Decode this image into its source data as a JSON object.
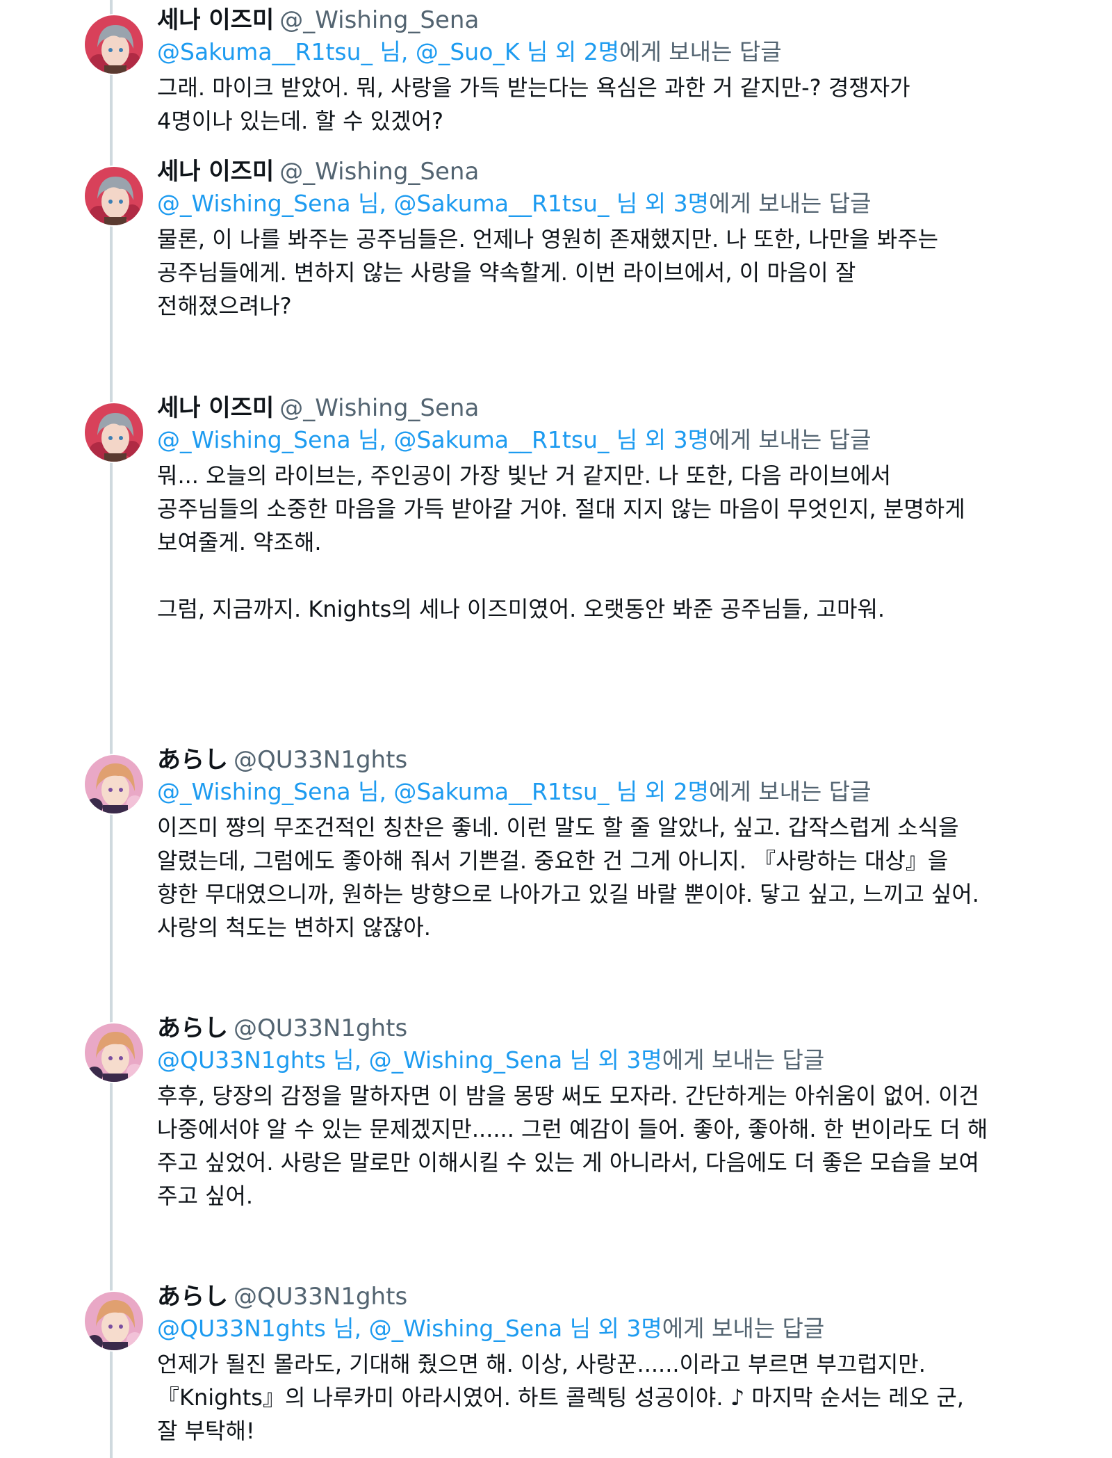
{
  "tweets": [
    {
      "display_name": "세나 이즈미",
      "handle": "@_Wishing_Sena",
      "reply_mentions": "@Sakuma__R1tsu_ 님, @_Suo_K 님 외 2명",
      "reply_suffix": "에게 보내는 답글",
      "text": "그래. 마이크 받았어. 뭐, 사랑을 가득 받는다는 욕심은 과한 거 같지만-? 경쟁자가\n4명이나 있는데. 할 수 있겠어?",
      "avatar_colors": {
        "bg": "#d8415a",
        "hair": "#9aa3ad",
        "skin": "#f3d6c8"
      }
    },
    {
      "display_name": "세나 이즈미",
      "handle": "@_Wishing_Sena",
      "reply_mentions": "@_Wishing_Sena 님, @Sakuma__R1tsu_ 님 외 3명",
      "reply_suffix": "에게 보내는 답글",
      "text": "물론, 이 나를 봐주는 공주님들은. 언제나 영원히 존재했지만. 나 또한, 나만을 봐주는\n공주님들에게. 변하지 않는 사랑을 약속할게. 이번 라이브에서, 이 마음이 잘\n전해졌으려나?",
      "avatar_colors": {
        "bg": "#d8415a",
        "hair": "#9aa3ad",
        "skin": "#f3d6c8"
      }
    },
    {
      "display_name": "세나 이즈미",
      "handle": "@_Wishing_Sena",
      "reply_mentions": "@_Wishing_Sena 님, @Sakuma__R1tsu_ 님 외 3명",
      "reply_suffix": "에게 보내는 답글",
      "text": "뭐... 오늘의 라이브는, 주인공이 가장 빛난 거 같지만. 나 또한, 다음 라이브에서\n공주님들의 소중한 마음을 가득 받아갈 거야. 절대 지지 않는 마음이 무엇인지, 분명하게\n보여줄게. 약조해.\n\n그럼, 지금까지. Knights의 세나 이즈미였어. 오랫동안 봐준 공주님들, 고마워.",
      "avatar_colors": {
        "bg": "#d8415a",
        "hair": "#9aa3ad",
        "skin": "#f3d6c8"
      }
    },
    {
      "display_name": "あらし",
      "handle": "@QU33N1ghts",
      "reply_mentions": "@_Wishing_Sena 님, @Sakuma__R1tsu_ 님 외 2명",
      "reply_suffix": "에게 보내는 답글",
      "text": "이즈미 쨩의 무조건적인 칭찬은 좋네. 이런 말도 할 줄 알았나, 싶고. 갑작스럽게 소식을\n알렸는데, 그럼에도 좋아해 줘서 기쁜걸. 중요한 건 그게 아니지. 『사랑하는 대상』을\n향한 무대였으니까, 원하는 방향으로 나아가고 있길 바랄 뿐이야. 닿고 싶고, 느끼고 싶어.\n사랑의 척도는 변하지 않잖아.",
      "avatar_colors": {
        "bg": "#e9a8c6",
        "hair": "#e0a070",
        "skin": "#f6dccd"
      }
    },
    {
      "display_name": "あらし",
      "handle": "@QU33N1ghts",
      "reply_mentions": "@QU33N1ghts 님, @_Wishing_Sena 님 외 3명",
      "reply_suffix": "에게 보내는 답글",
      "text": "후후, 당장의 감정을 말하자면 이 밤을 몽땅 써도 모자라. 간단하게는 아쉬움이 없어. 이건\n나중에서야 알 수 있는 문제겠지만...... 그런 예감이 들어. 좋아, 좋아해. 한 번이라도 더 해\n주고 싶었어. 사랑은 말로만 이해시킬 수 있는 게 아니라서, 다음에도 더 좋은 모습을 보여\n주고 싶어.",
      "avatar_colors": {
        "bg": "#e9a8c6",
        "hair": "#e0a070",
        "skin": "#f6dccd"
      }
    },
    {
      "display_name": "あらし",
      "handle": "@QU33N1ghts",
      "reply_mentions": "@QU33N1ghts 님, @_Wishing_Sena 님 외 3명",
      "reply_suffix": "에게 보내는 답글",
      "text": "언제가 될진 몰라도, 기대해 줬으면 해. 이상, 사랑꾼......이라고 부르면 부끄럽지만.\n『Knights』의 나루카미 아라시였어. 하트 콜렉팅 성공이야. ♪ 마지막 순서는 레오 군,\n잘 부탁해!",
      "avatar_colors": {
        "bg": "#e9a8c6",
        "hair": "#e0a070",
        "skin": "#f6dccd"
      }
    }
  ]
}
